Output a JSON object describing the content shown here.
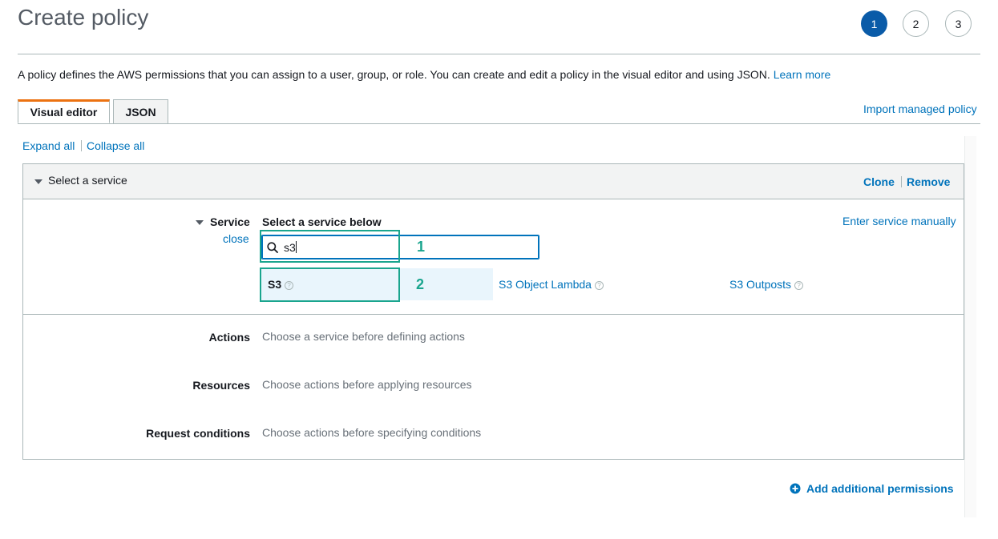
{
  "header": {
    "title": "Create policy",
    "steps": [
      "1",
      "2",
      "3"
    ]
  },
  "description": {
    "text": "A policy defines the AWS permissions that you can assign to a user, group, or role. You can create and edit a policy in the visual editor and using JSON.",
    "learn_more": "Learn more"
  },
  "tabs": {
    "visual_editor": "Visual editor",
    "json": "JSON",
    "import_managed_policy": "Import managed policy"
  },
  "toolbar": {
    "expand_all": "Expand all",
    "collapse_all": "Collapse all"
  },
  "section": {
    "title": "Select a service",
    "clone": "Clone",
    "remove": "Remove"
  },
  "service": {
    "label": "Service",
    "close": "close",
    "heading": "Select a service below",
    "enter_manually": "Enter service manually",
    "search_value": "s3",
    "results": [
      {
        "label": "S3",
        "help": "?"
      },
      {
        "label": "S3 Object Lambda",
        "help": "?"
      },
      {
        "label": "S3 Outposts",
        "help": "?"
      }
    ]
  },
  "annotations": {
    "box1": "1",
    "box2": "2",
    "color": "#1aa58e"
  },
  "rows": {
    "actions_label": "Actions",
    "actions_text": "Choose a service before defining actions",
    "resources_label": "Resources",
    "resources_text": "Choose actions before applying resources",
    "conditions_label": "Request conditions",
    "conditions_text": "Choose actions before specifying conditions"
  },
  "footer": {
    "add_permissions": "Add additional permissions"
  },
  "colors": {
    "accent": "#0073bb",
    "step_active": "#0a5ba8",
    "tab_active_border": "#ec7211"
  }
}
